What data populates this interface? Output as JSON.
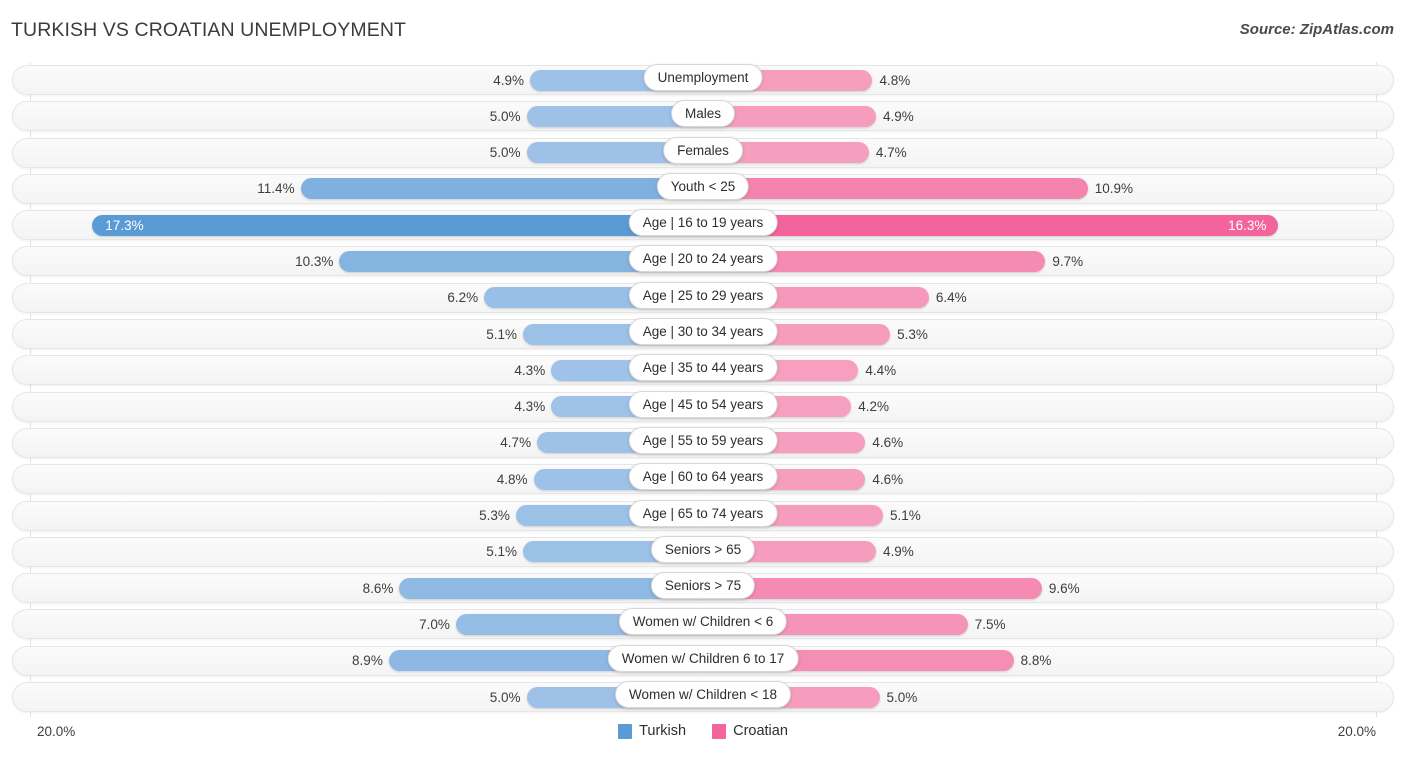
{
  "header": {
    "title": "TURKISH VS CROATIAN UNEMPLOYMENT",
    "source": "Source: ZipAtlas.com"
  },
  "axis": {
    "left_label": "20.0%",
    "right_label": "20.0%",
    "max": 20.0
  },
  "legend": {
    "items": [
      {
        "label": "Turkish",
        "color": "#5b9bd5"
      },
      {
        "label": "Croatian",
        "color": "#f2649b"
      }
    ]
  },
  "colors": {
    "turkish_light": "#a8c8ea",
    "turkish_dark": "#5b9bd5",
    "croatian_light": "#f7a8c4",
    "croatian_dark": "#f2649b",
    "track": "#f6f6f6",
    "gridline": "#e2e2e2"
  },
  "chart_data": {
    "type": "bar",
    "orientation": "diverging-horizontal",
    "title": "TURKISH VS CROATIAN UNEMPLOYMENT",
    "xlabel": "",
    "ylabel": "",
    "xlim": [
      20.0,
      20.0
    ],
    "grid": true,
    "legend_position": "bottom-center",
    "categories": [
      "Unemployment",
      "Males",
      "Females",
      "Youth < 25",
      "Age | 16 to 19 years",
      "Age | 20 to 24 years",
      "Age | 25 to 29 years",
      "Age | 30 to 34 years",
      "Age | 35 to 44 years",
      "Age | 45 to 54 years",
      "Age | 55 to 59 years",
      "Age | 60 to 64 years",
      "Age | 65 to 74 years",
      "Seniors > 65",
      "Seniors > 75",
      "Women w/ Children < 6",
      "Women w/ Children 6 to 17",
      "Women w/ Children < 18"
    ],
    "series": [
      {
        "name": "Turkish",
        "values": [
          4.9,
          5.0,
          5.0,
          11.4,
          17.3,
          10.3,
          6.2,
          5.1,
          4.3,
          4.3,
          4.7,
          4.8,
          5.3,
          5.1,
          8.6,
          7.0,
          8.9,
          5.0
        ],
        "labels": [
          "4.9%",
          "5.0%",
          "5.0%",
          "11.4%",
          "17.3%",
          "10.3%",
          "6.2%",
          "5.1%",
          "4.3%",
          "4.3%",
          "4.7%",
          "4.8%",
          "5.3%",
          "5.1%",
          "8.6%",
          "7.0%",
          "8.9%",
          "5.0%"
        ]
      },
      {
        "name": "Croatian",
        "values": [
          4.8,
          4.9,
          4.7,
          10.9,
          16.3,
          9.7,
          6.4,
          5.3,
          4.4,
          4.2,
          4.6,
          4.6,
          5.1,
          4.9,
          9.6,
          7.5,
          8.8,
          5.0
        ],
        "labels": [
          "4.8%",
          "4.9%",
          "4.7%",
          "10.9%",
          "16.3%",
          "9.7%",
          "6.4%",
          "5.3%",
          "4.4%",
          "4.2%",
          "4.6%",
          "4.6%",
          "5.1%",
          "4.9%",
          "9.6%",
          "7.5%",
          "8.8%",
          "5.0%"
        ]
      }
    ]
  }
}
